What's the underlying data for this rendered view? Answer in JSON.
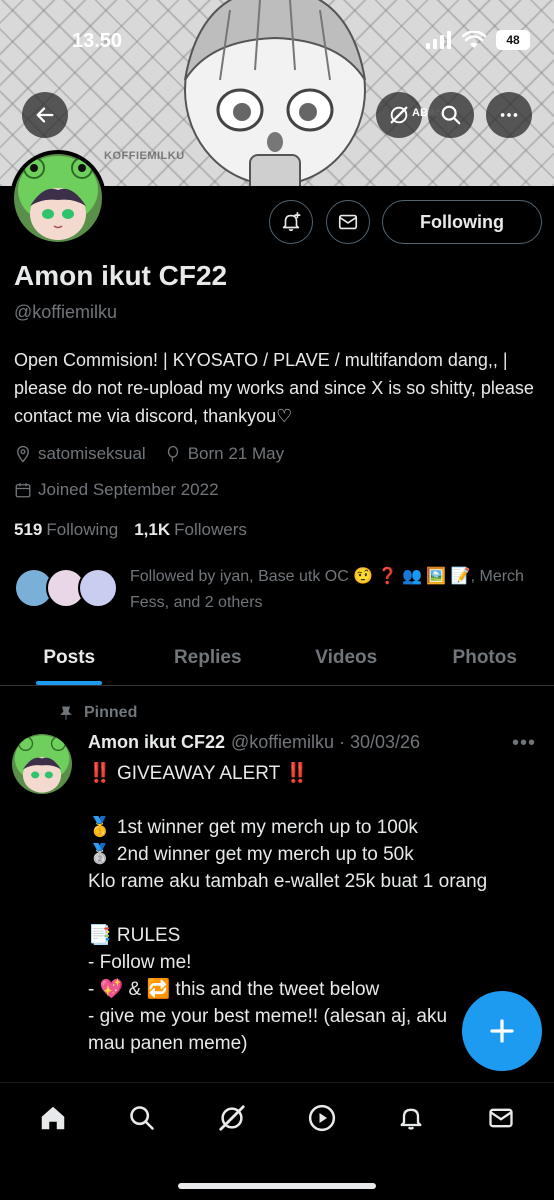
{
  "status_bar": {
    "time": "13.50",
    "battery": "48"
  },
  "banner": {
    "watermark": "KOFFIEMILKU",
    "overlay_label": "ABAN"
  },
  "profile": {
    "display_name": "Amon ikut CF22",
    "handle": "@koffiemilku",
    "bio": "Open Commision! | KYOSATO / PLAVE / multifandom dang,, | please do not re-upload my works and since X is so shitty, please contact me via discord, thankyou♡",
    "location": "satomiseksual",
    "birthday": "Born 21 May",
    "joined": "Joined September 2022",
    "following_count": "519",
    "following_label": "Following",
    "followers_count": "1,1K",
    "followers_label": "Followers",
    "followed_by": "Followed by iyan, Base utk OC 🤨 ❓ 👥 🖼️ 📝, Merch Fess, and 2 others",
    "follow_button": "Following"
  },
  "tabs": [
    {
      "label": "Posts",
      "active": true
    },
    {
      "label": "Replies",
      "active": false
    },
    {
      "label": "Videos",
      "active": false
    },
    {
      "label": "Photos",
      "active": false
    }
  ],
  "post": {
    "pinned_label": "Pinned",
    "author": "Amon ikut CF22",
    "handle_date": "@koffiemilku · 30/03/26",
    "lines": {
      "l1_mark": "‼️",
      "l1_text": "GIVEAWAY ALERT",
      "l2": "🥇 1st winner get my merch up to 100k",
      "l3": "🥈 2nd winner get my merch up to 50k",
      "l4": "Klo rame aku tambah e-wallet 25k buat 1 orang",
      "l5": "📑 RULES",
      "l6": "- Follow me!",
      "l7": "- 💖 & 🔁 this and the tweet below",
      "l8": "- give me your best meme!! (alesan aj, aku",
      "l9": "mau panen meme)"
    }
  },
  "nav": [
    "home-icon",
    "search-icon",
    "grok-icon",
    "video-icon",
    "notifications-icon",
    "messages-icon"
  ],
  "colors": {
    "accent": "#1d9bf0",
    "background": "#000000",
    "muted": "#71767b",
    "text": "#e7e9ea"
  }
}
